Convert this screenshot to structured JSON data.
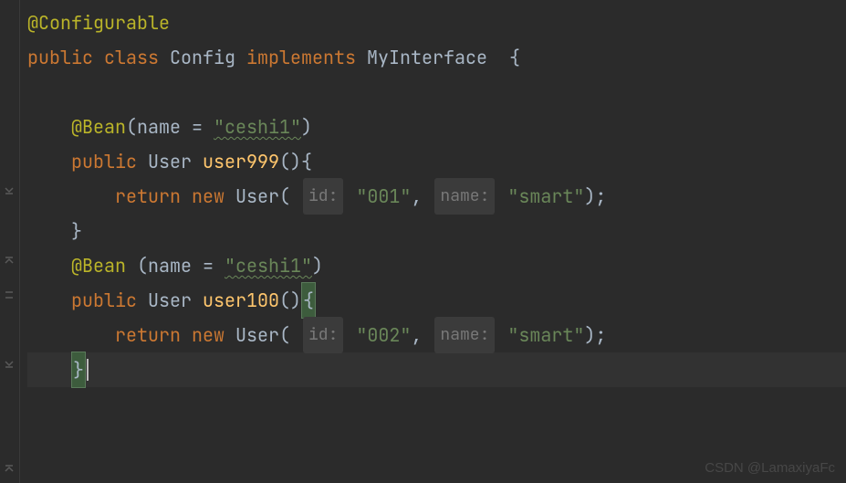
{
  "code": {
    "annotation_configurable": "@Configurable",
    "kw_public": "public",
    "kw_class": "class",
    "classname": "Config",
    "kw_implements": "implements",
    "interface": "MyInterface",
    "brace_open": "{",
    "brace_close": "}",
    "annotation_bean": "@Bean",
    "attr_name": "name",
    "eq": " = ",
    "bean1_value": "\"ceshi1\"",
    "bean2_value": "\"ceshi1\"",
    "type_user": "User",
    "method1": "user999",
    "method2": "user100",
    "parens": "()",
    "kw_return": "return",
    "kw_new": "new",
    "hint_id": "id:",
    "hint_name": "name:",
    "m1_arg1": "\"001\"",
    "m1_arg2": "\"smart\"",
    "m2_arg1": "\"002\"",
    "m2_arg2": "\"smart\"",
    "comma": ", ",
    "paren_open": "(",
    "paren_close": ")",
    "semicolon": ";"
  },
  "watermark": "CSDN @LamaxiyaFc"
}
